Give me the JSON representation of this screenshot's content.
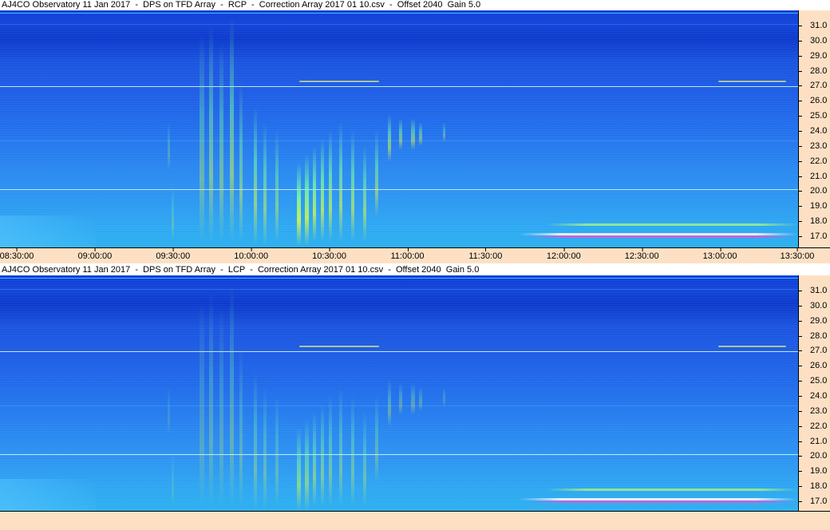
{
  "panels": [
    {
      "title": "AJ4CO Observatory 11 Jan 2017  -  DPS on TFD Array  -  RCP  -  Correction Array 2017 01 10.csv  -  Offset 2040  Gain 5.0",
      "freq_ticks": [
        "31.0",
        "30.0",
        "29.0",
        "28.0",
        "27.0",
        "26.0",
        "25.0",
        "24.0",
        "23.0",
        "22.0",
        "21.0",
        "20.0",
        "19.0",
        "18.0",
        "17.0"
      ]
    },
    {
      "title": "AJ4CO Observatory 11 Jan 2017  -  DPS on TFD Array  -  LCP  -  Correction Array 2017 01 10.csv  -  Offset 2040  Gain 5.0",
      "freq_ticks": [
        "31.0",
        "30.0",
        "29.0",
        "28.0",
        "27.0",
        "26.0",
        "25.0",
        "24.0",
        "23.0",
        "22.0",
        "21.0",
        "20.0",
        "19.0",
        "18.0",
        "17.0"
      ]
    }
  ],
  "time_axis": [
    "08:30:00",
    "09:00:00",
    "09:30:00",
    "10:00:00",
    "10:30:00",
    "11:00:00",
    "11:30:00",
    "12:00:00",
    "12:30:00",
    "13:00:00",
    "13:30:00"
  ]
}
